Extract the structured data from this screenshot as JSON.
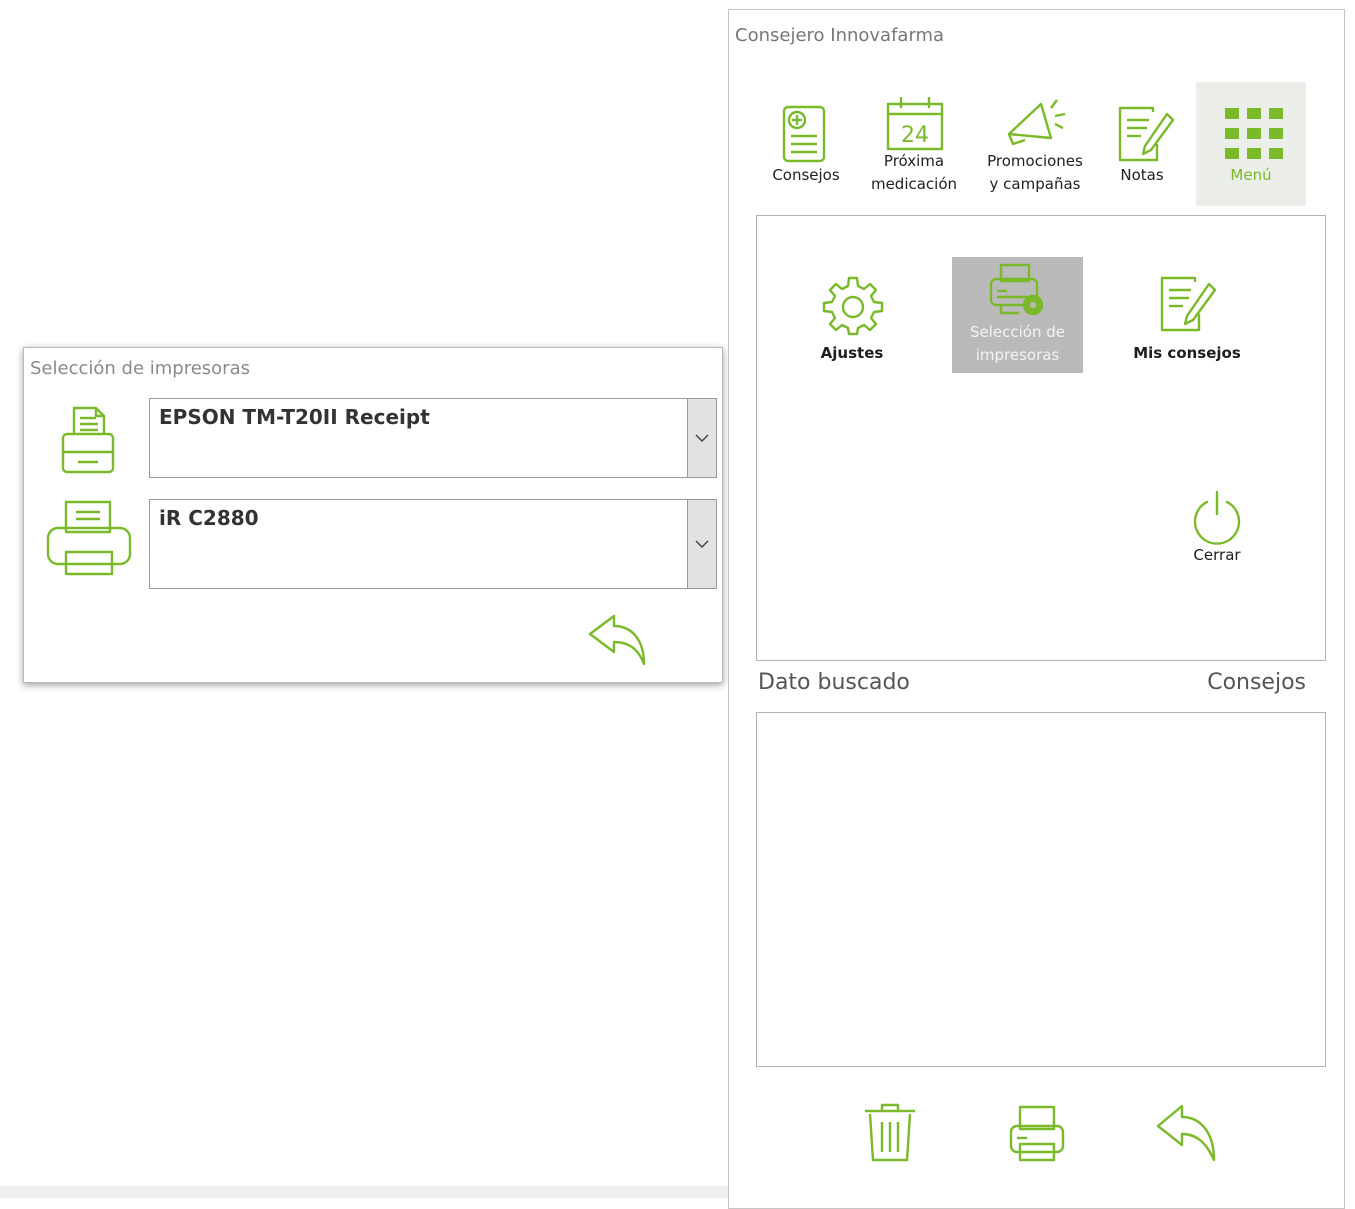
{
  "printer_dialog": {
    "title": "Selección de impresoras",
    "receipt_printer": {
      "icon": "receipt-printer-icon",
      "selected": "EPSON TM-T20II Receipt"
    },
    "document_printer": {
      "icon": "printer-icon",
      "selected": "iR C2880"
    },
    "back_icon": "back-arrow-icon"
  },
  "panel": {
    "title": "Consejero Innovafarma",
    "nav": [
      {
        "label": "Consejos",
        "icon": "advice-document-icon"
      },
      {
        "label": "Próxima medicación",
        "icon": "calendar-icon",
        "calendar_day": "24"
      },
      {
        "label": "Promociones y campañas",
        "icon": "megaphone-icon"
      },
      {
        "label": "Notas",
        "icon": "notes-icon"
      },
      {
        "label": "Menú",
        "icon": "grid-menu-icon",
        "active": true
      }
    ],
    "menu": {
      "settings": "Ajustes",
      "printer_selection": "Selección de impresoras",
      "my_advice": "Mis consejos",
      "close": "Cerrar"
    },
    "search_label": "Dato buscado",
    "advice_label": "Consejos",
    "bottom_icons": [
      "trash-icon",
      "print-icon",
      "back-arrow-icon"
    ]
  },
  "colors": {
    "accent": "#7ab929",
    "selected_bg": "#bababa",
    "active_nav_bg": "#eceeea"
  }
}
